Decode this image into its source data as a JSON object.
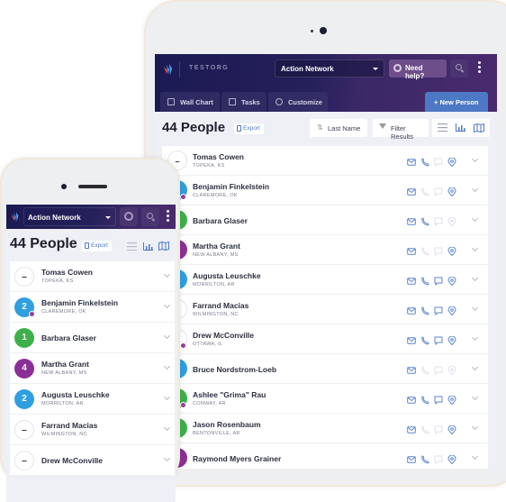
{
  "colors": {
    "header_start": "#1c1a52",
    "header_end": "#4a2a6e",
    "accent": "#4d78c4",
    "green": "#3cb04a",
    "blue": "#2f9fe0",
    "purple": "#8b2f97",
    "badge": "#9b3d9b"
  },
  "tablet": {
    "org_name": "TESTORG",
    "network_select": "Action Network",
    "help_label": "Need help?",
    "nav": [
      {
        "label": "Wall Chart",
        "icon": "wall-chart-icon"
      },
      {
        "label": "Tasks",
        "icon": "clipboard-icon"
      },
      {
        "label": "Customize",
        "icon": "customize-icon"
      }
    ],
    "new_person_label": "+ New Person",
    "title": "44 People",
    "export_label": "Export",
    "sort_label": "Last Name",
    "filter_label": "Filter Results",
    "people": [
      {
        "name": "Tomas Cowen",
        "loc": "TOPEKA, KS",
        "avatar": "–",
        "color": "empty",
        "badge": false,
        "email": true,
        "phone": true,
        "sms": false,
        "addr": true
      },
      {
        "name": "Benjamin Finkelstein",
        "loc": "CLAREMORE, OK",
        "avatar": "2",
        "color": "blue",
        "badge": true,
        "email": true,
        "phone": false,
        "sms": false,
        "addr": true
      },
      {
        "name": "Barbara Glaser",
        "loc": "",
        "avatar": "1",
        "color": "green",
        "badge": false,
        "email": true,
        "phone": true,
        "sms": false,
        "addr": false
      },
      {
        "name": "Martha Grant",
        "loc": "NEW ALBANY, MS",
        "avatar": "4",
        "color": "purple",
        "badge": false,
        "email": true,
        "phone": false,
        "sms": false,
        "addr": true
      },
      {
        "name": "Augusta Leuschke",
        "loc": "MORRILTON, AR",
        "avatar": "2",
        "color": "blue",
        "badge": false,
        "email": true,
        "phone": true,
        "sms": true,
        "addr": true
      },
      {
        "name": "Farrand Macias",
        "loc": "WILMINGTON, NC",
        "avatar": "–",
        "color": "empty",
        "badge": false,
        "email": true,
        "phone": true,
        "sms": true,
        "addr": true
      },
      {
        "name": "Drew McConville",
        "loc": "OTTAWA, IL",
        "avatar": "–",
        "color": "empty",
        "badge": true,
        "email": true,
        "phone": true,
        "sms": true,
        "addr": true
      },
      {
        "name": "Bruce Nordstrom-Loeb",
        "loc": "",
        "avatar": "2",
        "color": "blue",
        "badge": false,
        "email": true,
        "phone": false,
        "sms": false,
        "addr": false
      },
      {
        "name": "Ashlee \"Grima\" Rau",
        "loc": "CONWAY, AR",
        "avatar": "1",
        "color": "green",
        "badge": true,
        "email": true,
        "phone": true,
        "sms": true,
        "addr": true
      },
      {
        "name": "Jason Rosenbaum",
        "loc": "BENTONVILLE, AR",
        "avatar": "1",
        "color": "green",
        "badge": false,
        "email": true,
        "phone": false,
        "sms": false,
        "addr": true
      },
      {
        "name": "Raymond Myers Grainer",
        "loc": "",
        "avatar": "4",
        "color": "purple",
        "badge": false,
        "email": true,
        "phone": true,
        "sms": false,
        "addr": true
      }
    ]
  },
  "phone": {
    "network_select": "Action Network",
    "title": "44 People",
    "export_label": "Export",
    "people": [
      {
        "name": "Tomas Cowen",
        "loc": "TOPEKA, KS",
        "avatar": "–",
        "color": "empty",
        "badge": false
      },
      {
        "name": "Benjamin Finkelstein",
        "loc": "CLAREMORE, OK",
        "avatar": "2",
        "color": "blue",
        "badge": true
      },
      {
        "name": "Barbara Glaser",
        "loc": "",
        "avatar": "1",
        "color": "green",
        "badge": false
      },
      {
        "name": "Martha Grant",
        "loc": "NEW ALBANY, MS",
        "avatar": "4",
        "color": "purple",
        "badge": false
      },
      {
        "name": "Augusta Leuschke",
        "loc": "MORRILTON, AR",
        "avatar": "2",
        "color": "blue",
        "badge": false
      },
      {
        "name": "Farrand Macias",
        "loc": "WILMINGTON, NC",
        "avatar": "–",
        "color": "empty",
        "badge": false
      },
      {
        "name": "Drew McConville",
        "loc": "",
        "avatar": "–",
        "color": "empty",
        "badge": false
      }
    ]
  }
}
